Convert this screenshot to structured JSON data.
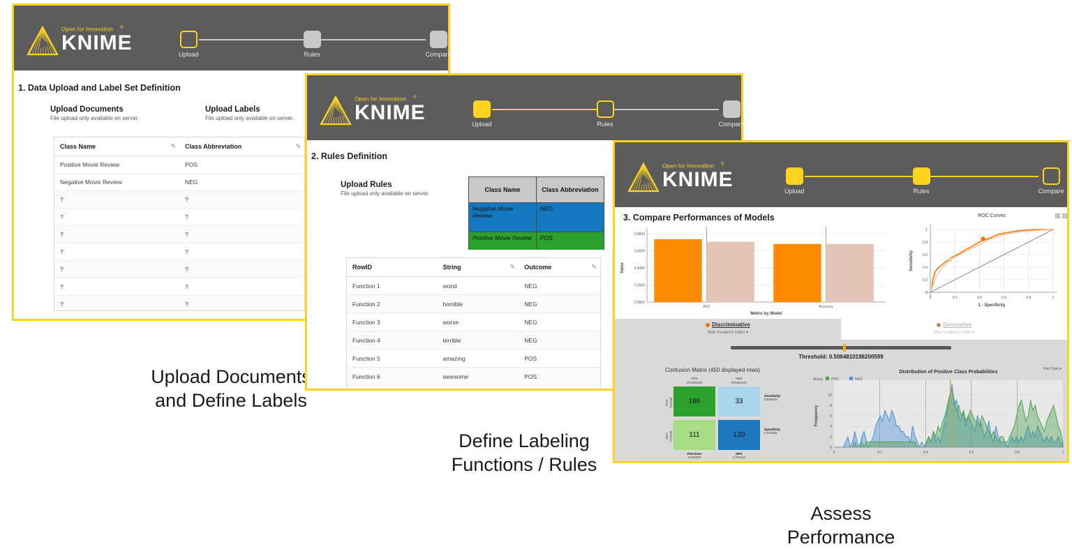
{
  "brand": {
    "tagline": "Open for Innovation",
    "name": "KNIME",
    "registered": "®"
  },
  "steps": [
    {
      "label": "Upload"
    },
    {
      "label": "Rules"
    },
    {
      "label": "Compare"
    }
  ],
  "panel1": {
    "section_title": "1. Data Upload and Label Set Definition",
    "upload_documents": {
      "title": "Upload Documents",
      "note": "File upload only available on server."
    },
    "upload_labels": {
      "title": "Upload Labels",
      "note": "File upload only available on server."
    },
    "table": {
      "columns": [
        "Class Name",
        "Class Abbreviation"
      ],
      "rows": [
        [
          "Positive Movie Review",
          "POS"
        ],
        [
          "Negative Movie Review",
          "NEG"
        ],
        [
          "?",
          "?"
        ],
        [
          "?",
          "?"
        ],
        [
          "?",
          "?"
        ],
        [
          "?",
          "?"
        ],
        [
          "?",
          "?"
        ],
        [
          "?",
          "?"
        ],
        [
          "?",
          "?"
        ],
        [
          "?",
          "?"
        ],
        [
          "?",
          "?"
        ]
      ]
    },
    "caption": "Upload Documents\nand Define Labels"
  },
  "panel2": {
    "section_title": "2. Rules Definition",
    "upload_rules": {
      "title": "Upload Rules",
      "note": "File upload only available on server."
    },
    "class_table": {
      "columns": [
        "Class Name",
        "Class Abbreviation"
      ],
      "rows": [
        {
          "name": "Negative Movie Review",
          "abbrev": "NEG",
          "color": "#1378BE"
        },
        {
          "name": "Positive Movie Review",
          "abbrev": "POS",
          "color": "#2DA12D"
        }
      ]
    },
    "rules_table": {
      "columns": [
        "RowID",
        "String",
        "Outcome"
      ],
      "rows": [
        [
          "Function 1",
          "worst",
          "NEG"
        ],
        [
          "Function 2",
          "horrible",
          "NEG"
        ],
        [
          "Function 3",
          "worse",
          "NEG"
        ],
        [
          "Function 4",
          "terrible",
          "NEG"
        ],
        [
          "Function 5",
          "amazing",
          "POS"
        ],
        [
          "Function 6",
          "awesome",
          "POS"
        ],
        [
          "",
          "",
          ""
        ]
      ]
    },
    "caption": "Define Labeling\nFunctions / Rules"
  },
  "panel3": {
    "section_title": "3. Compare Performances of Models",
    "tabs": [
      {
        "label": "Discriminative",
        "sub": "Max Youden's Index",
        "selected": true,
        "color": "#F07800"
      },
      {
        "label": "Generative",
        "sub": "Max Youden's Index",
        "selected": false,
        "color": "#C08A60"
      }
    ],
    "threshold_label": "Threshold: 0.5084810198200599",
    "threshold_value": 0.5084810198200599,
    "confusion_matrix": {
      "title": "Confusion Matrix (450 displayed rows)",
      "col_headers": [
        "POS\n(Predicted)",
        "NEG\n(Predicted)"
      ],
      "row_headers": [
        "POS\n(Actual)",
        "NEG\n(Actual)"
      ],
      "cells": [
        [
          {
            "value": "186",
            "color": "#2DA12D"
          },
          {
            "value": "33",
            "color": "#A9D4EA"
          }
        ],
        [
          {
            "value": "111",
            "color": "#A7DB84"
          },
          {
            "value": "120",
            "color": "#1E78BE"
          }
        ]
      ],
      "right_metrics": [
        {
          "name": "Sensitivity",
          "value": "0.849315"
        },
        {
          "name": "Specificity",
          "value": "0.519481"
        }
      ],
      "bottom_metrics": [
        {
          "name": "Precision",
          "value": "0.626263"
        },
        {
          "name": "NPV",
          "value": "0.784314"
        }
      ]
    },
    "dist_chart_dropdown": "Dist Chart",
    "chart_data": [
      {
        "type": "bar",
        "title": "",
        "categories": [
          "AUC",
          "Accuracy"
        ],
        "series": [
          {
            "name": "Discriminative",
            "color": "#FF8C00",
            "values": [
              0.735,
              0.68
            ]
          },
          {
            "name": "Generative",
            "color": "#E3C6B6",
            "values": [
              0.705,
              0.68
            ]
          }
        ],
        "xlabel": "Metric by Model",
        "ylabel": "Value",
        "ylim": [
          0.0,
          0.8
        ],
        "yticks": [
          "0.0000",
          "0.2000",
          "0.4000",
          "0.6000",
          "0.8000"
        ],
        "grid": true
      },
      {
        "type": "line",
        "title": "ROC Curves",
        "xlabel": "1 - Specificity",
        "ylabel": "Sensitivity",
        "xlim": [
          0,
          1
        ],
        "ylim": [
          0,
          1
        ],
        "xticks": [
          "0",
          "0.2",
          "0.4",
          "0.6",
          "0.8",
          "1"
        ],
        "yticks": [
          "0",
          "0.2",
          "0.4",
          "0.6",
          "0.8",
          "1"
        ],
        "grid": true,
        "series": [
          {
            "name": "Discriminative",
            "color": "#F07800",
            "points": [
              [
                0,
                0
              ],
              [
                0.01,
                0.04
              ],
              [
                0.015,
                0.12
              ],
              [
                0.02,
                0.2
              ],
              [
                0.03,
                0.26
              ],
              [
                0.04,
                0.33
              ],
              [
                0.06,
                0.38
              ],
              [
                0.09,
                0.43
              ],
              [
                0.12,
                0.48
              ],
              [
                0.16,
                0.54
              ],
              [
                0.2,
                0.58
              ],
              [
                0.24,
                0.62
              ],
              [
                0.28,
                0.67
              ],
              [
                0.33,
                0.72
              ],
              [
                0.38,
                0.78
              ],
              [
                0.43,
                0.83
              ],
              [
                0.48,
                0.86
              ],
              [
                0.55,
                0.92
              ],
              [
                0.62,
                0.95
              ],
              [
                0.72,
                0.98
              ],
              [
                0.85,
                1.0
              ],
              [
                1,
                1
              ]
            ],
            "marker": {
              "x": 0.43,
              "y": 0.85
            }
          },
          {
            "name": "Generative",
            "color": "#F3C9A8",
            "points": [
              [
                0,
                0
              ],
              [
                0.02,
                0.1
              ],
              [
                0.04,
                0.22
              ],
              [
                0.07,
                0.32
              ],
              [
                0.11,
                0.42
              ],
              [
                0.16,
                0.52
              ],
              [
                0.22,
                0.58
              ],
              [
                0.3,
                0.66
              ],
              [
                0.38,
                0.74
              ],
              [
                0.48,
                0.84
              ],
              [
                0.6,
                0.92
              ],
              [
                0.75,
                0.97
              ],
              [
                1,
                1
              ]
            ],
            "marker": {
              "x": 0.16,
              "y": 0.52
            }
          },
          {
            "name": "diagonal",
            "color": "#777777",
            "points": [
              [
                0,
                0
              ],
              [
                1,
                1
              ]
            ]
          }
        ]
      },
      {
        "type": "area",
        "title": "Distribution of Positive Class Probabilities",
        "legend_title": "Actual",
        "legend": [
          {
            "name": "POS",
            "color": "#4FA34F"
          },
          {
            "name": "NEG",
            "color": "#4A90D9"
          }
        ],
        "xlabel": "",
        "ylabel": "Frequency",
        "xlim": [
          0,
          1
        ],
        "ylim": [
          0,
          12
        ],
        "xticks": [
          "0",
          "0.2",
          "0.4",
          "0.6",
          "0.8",
          "1"
        ],
        "yticks": [
          "0",
          "2",
          "4",
          "6",
          "8",
          "10"
        ],
        "marker_x": 0.5084810198200599,
        "series": [
          {
            "name": "NEG",
            "color": "#4A90D9",
            "values": [
              0,
              0,
              0,
              0,
              0,
              1,
              2,
              0,
              1,
              3,
              1,
              0,
              2,
              3,
              1,
              0,
              1,
              2,
              4,
              5,
              6,
              5,
              7,
              6,
              5,
              7,
              6,
              4,
              4,
              3,
              3,
              2,
              2,
              1,
              4,
              2,
              1,
              0,
              1,
              0,
              1,
              2,
              1,
              3,
              1,
              2,
              1,
              3,
              5,
              7,
              9,
              12,
              8,
              9,
              6,
              5,
              7,
              4,
              6,
              5,
              4,
              3,
              6,
              5,
              4,
              2,
              3,
              5,
              2,
              1,
              4,
              2,
              1,
              1,
              1,
              0,
              1,
              2,
              1,
              2,
              1,
              2,
              1,
              3,
              4,
              2,
              3,
              2,
              4,
              3,
              2,
              1,
              2,
              1,
              2,
              1,
              1,
              2,
              1,
              0
            ]
          },
          {
            "name": "POS",
            "color": "#4FA34F",
            "values": [
              0,
              0,
              0,
              0,
              0,
              0,
              0,
              0,
              0,
              1,
              0,
              0,
              1,
              0,
              1,
              1,
              1,
              1,
              1,
              1,
              1,
              1,
              1,
              1,
              1,
              1,
              1,
              1,
              1,
              1,
              1,
              1,
              1,
              1,
              1,
              1,
              0,
              0,
              0,
              0,
              1,
              2,
              1,
              3,
              2,
              4,
              3,
              5,
              6,
              8,
              10,
              11,
              9,
              7,
              8,
              6,
              7,
              5,
              6,
              7,
              6,
              5,
              5,
              4,
              6,
              5,
              4,
              3,
              2,
              3,
              2,
              1,
              2,
              2,
              1,
              1,
              2,
              3,
              4,
              6,
              8,
              9,
              7,
              5,
              6,
              9,
              7,
              8,
              6,
              5,
              4,
              3,
              5,
              6,
              7,
              8,
              6,
              4,
              3,
              1
            ]
          }
        ]
      }
    ],
    "caption": "Assess\nPerformance"
  }
}
